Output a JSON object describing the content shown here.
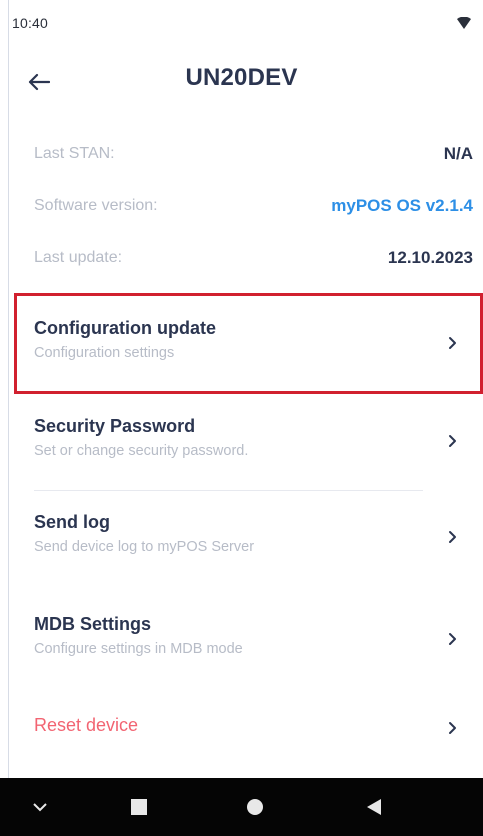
{
  "status_bar": {
    "time": "10:40",
    "signal_icon": "wifi-signal-icon"
  },
  "app_bar": {
    "title": "UN20DEV",
    "back_icon": "arrow-left-icon"
  },
  "info": {
    "last_stan": {
      "label": "Last STAN:",
      "value": "N/A"
    },
    "software_version": {
      "label": "Software version:",
      "value": "myPOS OS v2.1.4",
      "value_color": "#2d8fe6"
    },
    "last_update": {
      "label": "Last update:",
      "value": "12.10.2023"
    }
  },
  "menu": [
    {
      "title": "Configuration update",
      "subtitle": "Configuration settings",
      "highlighted": true
    },
    {
      "title": "Security Password",
      "subtitle": "Set or change security password."
    },
    {
      "title": "Send log",
      "subtitle": "Send device log to myPOS Server"
    },
    {
      "title": "MDB Settings",
      "subtitle": "Configure settings in MDB mode"
    },
    {
      "title": "Reset device",
      "subtitle": "",
      "danger": true,
      "color": "#f26472"
    }
  ],
  "nav_bar": {
    "icons": [
      "chevron-down-icon",
      "recents-icon",
      "home-icon",
      "back-triangle-icon"
    ]
  },
  "colors": {
    "primary_text": "#2b3550",
    "muted_text": "#b7bcc7",
    "highlight_border": "#d1202f"
  }
}
